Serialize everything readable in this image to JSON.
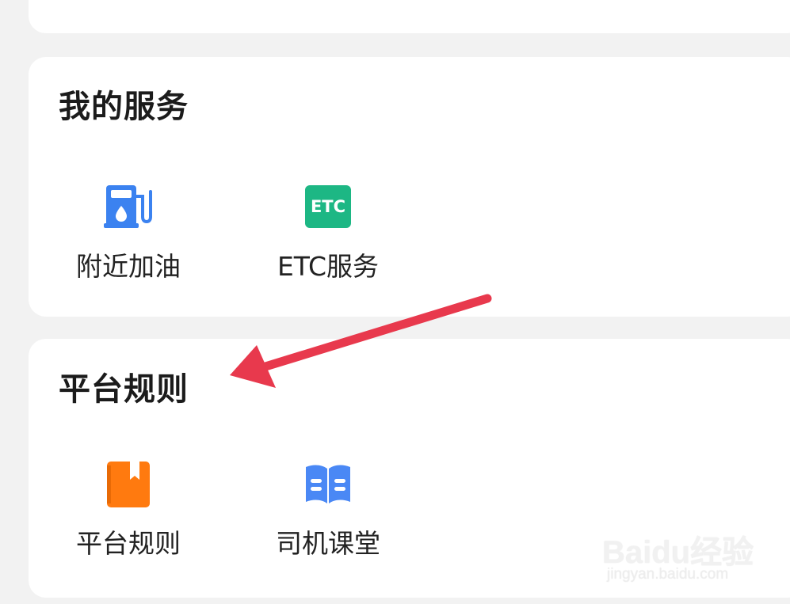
{
  "services": {
    "title": "我的服务",
    "items": [
      {
        "label": "附近加油",
        "icon": "fuel-pump-icon",
        "color": "#3b82f0"
      },
      {
        "label": "ETC服务",
        "icon": "etc-icon",
        "icon_text": "ETC",
        "color": "#1db784"
      }
    ]
  },
  "rules": {
    "title": "平台规则",
    "items": [
      {
        "label": "平台规则",
        "icon": "rulebook-icon",
        "color": "#ff7a0f"
      },
      {
        "label": "司机课堂",
        "icon": "open-book-icon",
        "color": "#4a88f5"
      }
    ]
  },
  "annotation": {
    "arrow_color": "#e8394d"
  },
  "watermark": {
    "brand": "Baidu经验",
    "url": "jingyan.baidu.com"
  }
}
